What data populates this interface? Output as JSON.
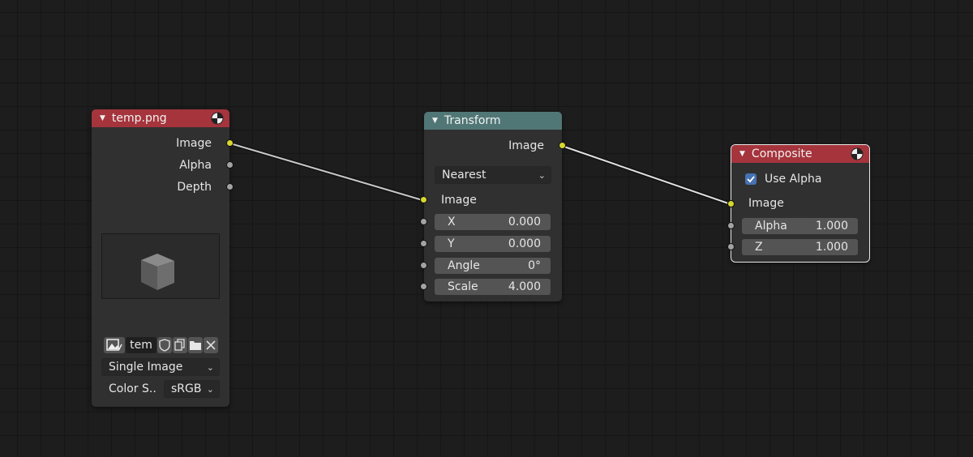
{
  "nodes": {
    "image_node": {
      "title": "temp.png",
      "outputs": [
        "Image",
        "Alpha",
        "Depth"
      ],
      "image_name": "tem",
      "source_type": "Single Image",
      "color_space_label": "Color S..",
      "color_space_value": "sRGB"
    },
    "transform_node": {
      "title": "Transform",
      "output": "Image",
      "filter": "Nearest",
      "input_image": "Image",
      "inputs": [
        {
          "label": "X",
          "value": "0.000"
        },
        {
          "label": "Y",
          "value": "0.000"
        },
        {
          "label": "Angle",
          "value": "0°"
        },
        {
          "label": "Scale",
          "value": "4.000"
        }
      ]
    },
    "composite_node": {
      "title": "Composite",
      "use_alpha_label": "Use Alpha",
      "use_alpha_checked": true,
      "input_image": "Image",
      "inputs": [
        {
          "label": "Alpha",
          "value": "1.000"
        },
        {
          "label": "Z",
          "value": "1.000"
        }
      ]
    }
  },
  "colors": {
    "header_input_output": "#a5343c",
    "header_transform": "#507776",
    "socket_image": "#d8d82e",
    "socket_value": "#a3a3a3",
    "checkbox": "#4772b3"
  },
  "icons": [
    "render-icon",
    "image-type-icon",
    "fake-user-icon",
    "duplicate-icon",
    "open-file-icon",
    "close-icon",
    "chevron-down-icon",
    "checkmark-icon"
  ]
}
